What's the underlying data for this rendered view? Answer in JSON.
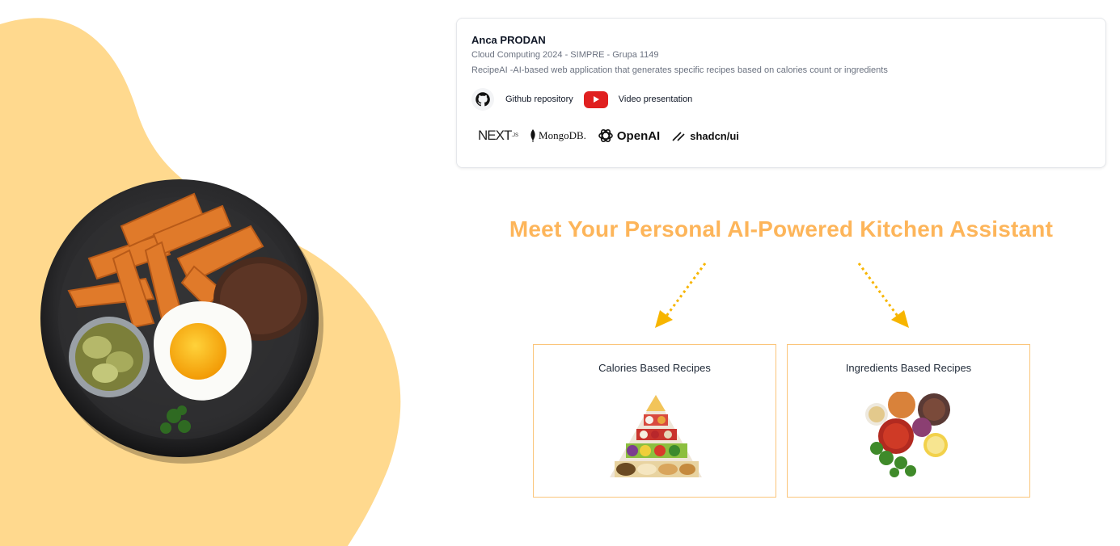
{
  "author": {
    "name": "Anca PRODAN",
    "course": "Cloud Computing 2024 - SIMPRE - Grupa 1149",
    "description": "RecipeAI -AI-based web application that generates specific recipes based on calories count or ingredients"
  },
  "links": {
    "github_label": "Github repository",
    "video_label": "Video presentation"
  },
  "tech_stack": {
    "next_label": "NEXT",
    "next_suffix": ".JS",
    "mongodb_label": "MongoDB.",
    "openai_label": "OpenAI",
    "shadcn_label": "shadcn/ui"
  },
  "headline": "Meet Your Personal AI-Powered Kitchen Assistant",
  "cards": [
    {
      "title": "Calories Based Recipes",
      "image": "food-pyramid"
    },
    {
      "title": "Ingredients Based Recipes",
      "image": "ingredients-bowls"
    }
  ],
  "colors": {
    "accent": "#fdb55a",
    "blob": "#ffd98e",
    "arrow": "#f7b500",
    "card_border": "#fbc57a",
    "youtube": "#e02020"
  }
}
